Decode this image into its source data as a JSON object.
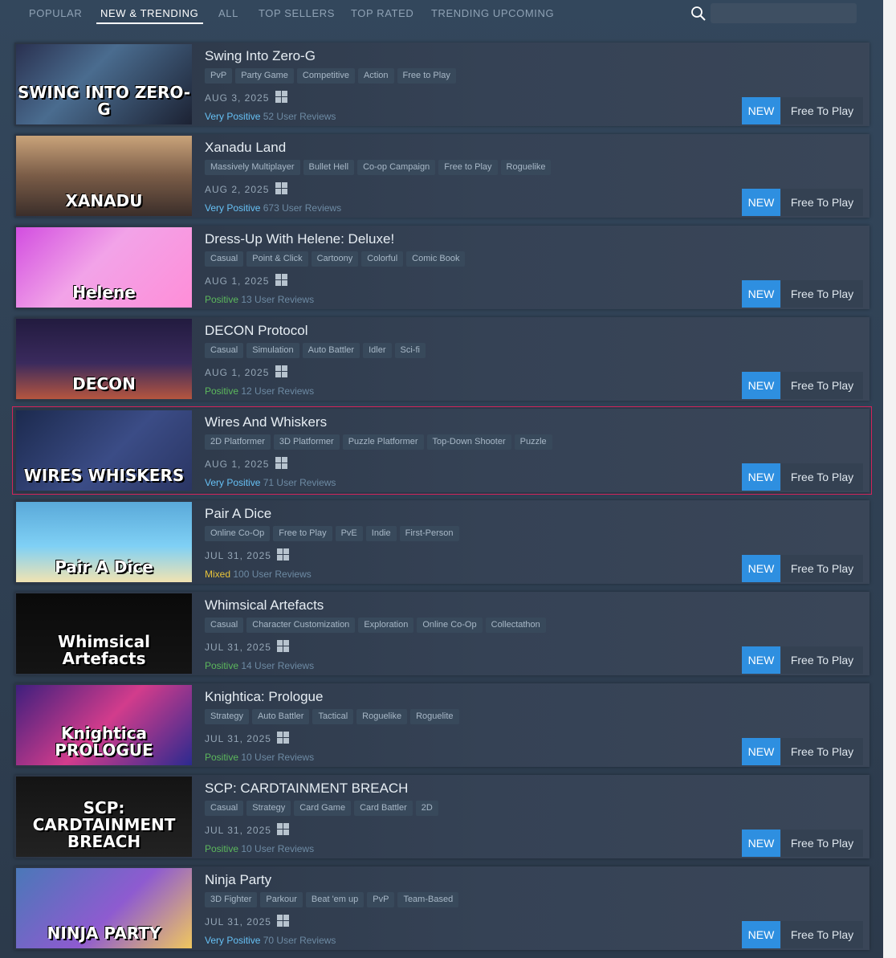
{
  "nav": {
    "tabs": [
      {
        "label": "POPULAR",
        "active": false
      },
      {
        "label": "NEW & TRENDING",
        "active": true
      },
      {
        "label": "ALL",
        "active": false
      },
      {
        "label": "TOP SELLERS",
        "active": false
      },
      {
        "label": "TOP RATED",
        "active": false
      },
      {
        "label": "TRENDING UPCOMING",
        "active": false
      }
    ],
    "search_icon": "search-icon",
    "search_placeholder": ""
  },
  "colors": {
    "accent": "#2e8fe0",
    "very_positive": "#66c0f4",
    "positive": "#5cb85c",
    "mixed": "#e8c43a",
    "highlight_border": "#d2245a"
  },
  "games": [
    {
      "title": "Swing Into Zero-G",
      "capsule_text": "SWING INTO ZERO-G",
      "tags": [
        "PvP",
        "Party Game",
        "Competitive",
        "Action",
        "Free to Play"
      ],
      "date": "AUG 3, 2025",
      "platform_icon": "windows-icon",
      "review_label": "Very Positive",
      "review_count": "52 User Reviews",
      "badge": "NEW",
      "price": "Free To Play"
    },
    {
      "title": "Xanadu Land",
      "capsule_text": "XANADU",
      "tags": [
        "Massively Multiplayer",
        "Bullet Hell",
        "Co-op Campaign",
        "Free to Play",
        "Roguelike"
      ],
      "date": "AUG 2, 2025",
      "platform_icon": "windows-icon",
      "review_label": "Very Positive",
      "review_count": "673 User Reviews",
      "badge": "NEW",
      "price": "Free To Play"
    },
    {
      "title": "Dress-Up With Helene: Deluxe!",
      "capsule_text": "Helene",
      "tags": [
        "Casual",
        "Point & Click",
        "Cartoony",
        "Colorful",
        "Comic Book"
      ],
      "date": "AUG 1, 2025",
      "platform_icon": "windows-icon",
      "review_label": "Positive",
      "review_count": "13 User Reviews",
      "badge": "NEW",
      "price": "Free To Play"
    },
    {
      "title": "DECON Protocol",
      "capsule_text": "DECON",
      "tags": [
        "Casual",
        "Simulation",
        "Auto Battler",
        "Idler",
        "Sci-fi"
      ],
      "date": "AUG 1, 2025",
      "platform_icon": "windows-icon",
      "review_label": "Positive",
      "review_count": "12 User Reviews",
      "badge": "NEW",
      "price": "Free To Play"
    },
    {
      "title": "Wires And Whiskers",
      "capsule_text": "WIRES WHISKERS",
      "tags": [
        "2D Platformer",
        "3D Platformer",
        "Puzzle Platformer",
        "Top-Down Shooter",
        "Puzzle"
      ],
      "date": "AUG 1, 2025",
      "platform_icon": "windows-icon",
      "review_label": "Very Positive",
      "review_count": "71 User Reviews",
      "badge": "NEW",
      "price": "Free To Play"
    },
    {
      "title": "Pair A Dice",
      "capsule_text": "Pair A Dice",
      "tags": [
        "Online Co-Op",
        "Free to Play",
        "PvE",
        "Indie",
        "First-Person"
      ],
      "date": "JUL 31, 2025",
      "platform_icon": "windows-icon",
      "review_label": "Mixed",
      "review_count": "100 User Reviews",
      "badge": "NEW",
      "price": "Free To Play"
    },
    {
      "title": "Whimsical Artefacts",
      "capsule_text": "Whimsical Artefacts",
      "tags": [
        "Casual",
        "Character Customization",
        "Exploration",
        "Online Co-Op",
        "Collectathon"
      ],
      "date": "JUL 31, 2025",
      "platform_icon": "windows-icon",
      "review_label": "Positive",
      "review_count": "14 User Reviews",
      "badge": "NEW",
      "price": "Free To Play"
    },
    {
      "title": "Knightica: Prologue",
      "capsule_text": "Knightica PROLOGUE",
      "tags": [
        "Strategy",
        "Auto Battler",
        "Tactical",
        "Roguelike",
        "Roguelite"
      ],
      "date": "JUL 31, 2025",
      "platform_icon": "windows-icon",
      "review_label": "Positive",
      "review_count": "10 User Reviews",
      "badge": "NEW",
      "price": "Free To Play"
    },
    {
      "title": "SCP: CARDTAINMENT BREACH",
      "capsule_text": "SCP: CARDTAINMENT BREACH",
      "tags": [
        "Casual",
        "Strategy",
        "Card Game",
        "Card Battler",
        "2D"
      ],
      "date": "JUL 31, 2025",
      "platform_icon": "windows-icon",
      "review_label": "Positive",
      "review_count": "10 User Reviews",
      "badge": "NEW",
      "price": "Free To Play"
    },
    {
      "title": "Ninja Party",
      "capsule_text": "NINJA PARTY",
      "tags": [
        "3D Fighter",
        "Parkour",
        "Beat 'em up",
        "PvP",
        "Team-Based"
      ],
      "date": "JUL 31, 2025",
      "platform_icon": "windows-icon",
      "review_label": "Very Positive",
      "review_count": "70 User Reviews",
      "badge": "NEW",
      "price": "Free To Play"
    }
  ]
}
